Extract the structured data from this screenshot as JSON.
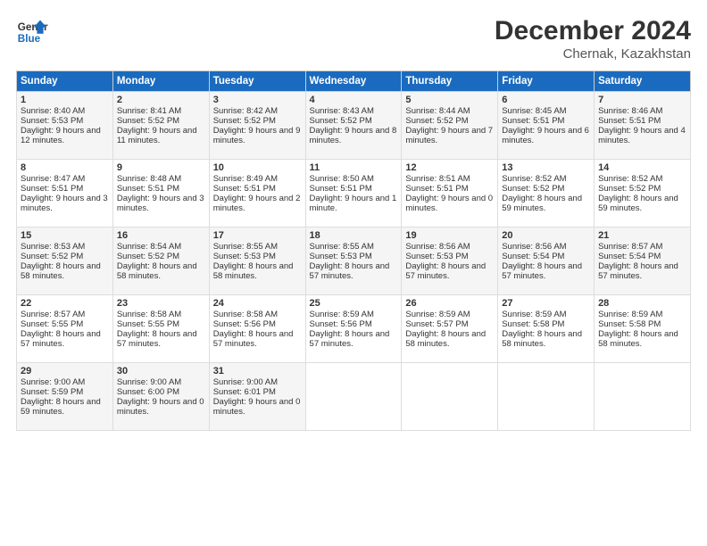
{
  "header": {
    "logo_line1": "General",
    "logo_line2": "Blue",
    "month": "December 2024",
    "location": "Chernak, Kazakhstan"
  },
  "days_of_week": [
    "Sunday",
    "Monday",
    "Tuesday",
    "Wednesday",
    "Thursday",
    "Friday",
    "Saturday"
  ],
  "weeks": [
    [
      {
        "day": "1",
        "sunrise": "Sunrise: 8:40 AM",
        "sunset": "Sunset: 5:53 PM",
        "daylight": "Daylight: 9 hours and 12 minutes."
      },
      {
        "day": "2",
        "sunrise": "Sunrise: 8:41 AM",
        "sunset": "Sunset: 5:52 PM",
        "daylight": "Daylight: 9 hours and 11 minutes."
      },
      {
        "day": "3",
        "sunrise": "Sunrise: 8:42 AM",
        "sunset": "Sunset: 5:52 PM",
        "daylight": "Daylight: 9 hours and 9 minutes."
      },
      {
        "day": "4",
        "sunrise": "Sunrise: 8:43 AM",
        "sunset": "Sunset: 5:52 PM",
        "daylight": "Daylight: 9 hours and 8 minutes."
      },
      {
        "day": "5",
        "sunrise": "Sunrise: 8:44 AM",
        "sunset": "Sunset: 5:52 PM",
        "daylight": "Daylight: 9 hours and 7 minutes."
      },
      {
        "day": "6",
        "sunrise": "Sunrise: 8:45 AM",
        "sunset": "Sunset: 5:51 PM",
        "daylight": "Daylight: 9 hours and 6 minutes."
      },
      {
        "day": "7",
        "sunrise": "Sunrise: 8:46 AM",
        "sunset": "Sunset: 5:51 PM",
        "daylight": "Daylight: 9 hours and 4 minutes."
      }
    ],
    [
      {
        "day": "8",
        "sunrise": "Sunrise: 8:47 AM",
        "sunset": "Sunset: 5:51 PM",
        "daylight": "Daylight: 9 hours and 3 minutes."
      },
      {
        "day": "9",
        "sunrise": "Sunrise: 8:48 AM",
        "sunset": "Sunset: 5:51 PM",
        "daylight": "Daylight: 9 hours and 3 minutes."
      },
      {
        "day": "10",
        "sunrise": "Sunrise: 8:49 AM",
        "sunset": "Sunset: 5:51 PM",
        "daylight": "Daylight: 9 hours and 2 minutes."
      },
      {
        "day": "11",
        "sunrise": "Sunrise: 8:50 AM",
        "sunset": "Sunset: 5:51 PM",
        "daylight": "Daylight: 9 hours and 1 minute."
      },
      {
        "day": "12",
        "sunrise": "Sunrise: 8:51 AM",
        "sunset": "Sunset: 5:51 PM",
        "daylight": "Daylight: 9 hours and 0 minutes."
      },
      {
        "day": "13",
        "sunrise": "Sunrise: 8:52 AM",
        "sunset": "Sunset: 5:52 PM",
        "daylight": "Daylight: 8 hours and 59 minutes."
      },
      {
        "day": "14",
        "sunrise": "Sunrise: 8:52 AM",
        "sunset": "Sunset: 5:52 PM",
        "daylight": "Daylight: 8 hours and 59 minutes."
      }
    ],
    [
      {
        "day": "15",
        "sunrise": "Sunrise: 8:53 AM",
        "sunset": "Sunset: 5:52 PM",
        "daylight": "Daylight: 8 hours and 58 minutes."
      },
      {
        "day": "16",
        "sunrise": "Sunrise: 8:54 AM",
        "sunset": "Sunset: 5:52 PM",
        "daylight": "Daylight: 8 hours and 58 minutes."
      },
      {
        "day": "17",
        "sunrise": "Sunrise: 8:55 AM",
        "sunset": "Sunset: 5:53 PM",
        "daylight": "Daylight: 8 hours and 58 minutes."
      },
      {
        "day": "18",
        "sunrise": "Sunrise: 8:55 AM",
        "sunset": "Sunset: 5:53 PM",
        "daylight": "Daylight: 8 hours and 57 minutes."
      },
      {
        "day": "19",
        "sunrise": "Sunrise: 8:56 AM",
        "sunset": "Sunset: 5:53 PM",
        "daylight": "Daylight: 8 hours and 57 minutes."
      },
      {
        "day": "20",
        "sunrise": "Sunrise: 8:56 AM",
        "sunset": "Sunset: 5:54 PM",
        "daylight": "Daylight: 8 hours and 57 minutes."
      },
      {
        "day": "21",
        "sunrise": "Sunrise: 8:57 AM",
        "sunset": "Sunset: 5:54 PM",
        "daylight": "Daylight: 8 hours and 57 minutes."
      }
    ],
    [
      {
        "day": "22",
        "sunrise": "Sunrise: 8:57 AM",
        "sunset": "Sunset: 5:55 PM",
        "daylight": "Daylight: 8 hours and 57 minutes."
      },
      {
        "day": "23",
        "sunrise": "Sunrise: 8:58 AM",
        "sunset": "Sunset: 5:55 PM",
        "daylight": "Daylight: 8 hours and 57 minutes."
      },
      {
        "day": "24",
        "sunrise": "Sunrise: 8:58 AM",
        "sunset": "Sunset: 5:56 PM",
        "daylight": "Daylight: 8 hours and 57 minutes."
      },
      {
        "day": "25",
        "sunrise": "Sunrise: 8:59 AM",
        "sunset": "Sunset: 5:56 PM",
        "daylight": "Daylight: 8 hours and 57 minutes."
      },
      {
        "day": "26",
        "sunrise": "Sunrise: 8:59 AM",
        "sunset": "Sunset: 5:57 PM",
        "daylight": "Daylight: 8 hours and 58 minutes."
      },
      {
        "day": "27",
        "sunrise": "Sunrise: 8:59 AM",
        "sunset": "Sunset: 5:58 PM",
        "daylight": "Daylight: 8 hours and 58 minutes."
      },
      {
        "day": "28",
        "sunrise": "Sunrise: 8:59 AM",
        "sunset": "Sunset: 5:58 PM",
        "daylight": "Daylight: 8 hours and 58 minutes."
      }
    ],
    [
      {
        "day": "29",
        "sunrise": "Sunrise: 9:00 AM",
        "sunset": "Sunset: 5:59 PM",
        "daylight": "Daylight: 8 hours and 59 minutes."
      },
      {
        "day": "30",
        "sunrise": "Sunrise: 9:00 AM",
        "sunset": "Sunset: 6:00 PM",
        "daylight": "Daylight: 9 hours and 0 minutes."
      },
      {
        "day": "31",
        "sunrise": "Sunrise: 9:00 AM",
        "sunset": "Sunset: 6:01 PM",
        "daylight": "Daylight: 9 hours and 0 minutes."
      },
      null,
      null,
      null,
      null
    ]
  ]
}
